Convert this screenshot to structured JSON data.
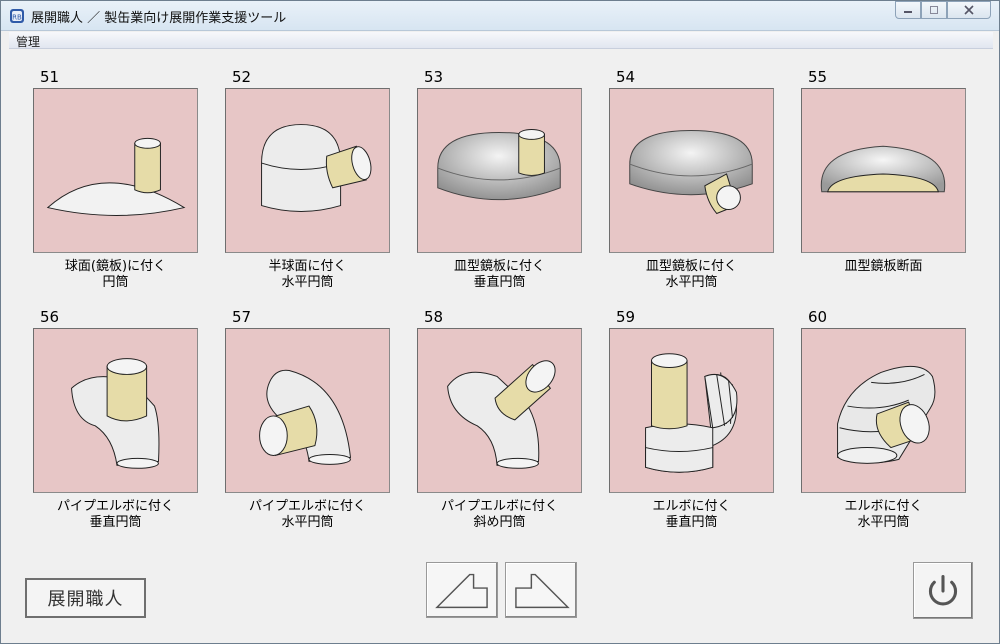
{
  "window": {
    "title": "展開職人 ／ 製缶業向け展開作業支援ツール",
    "icon": "app-logo-icon",
    "controls": [
      "minimize",
      "maximize",
      "close"
    ]
  },
  "menu": {
    "items": [
      {
        "label": "管理"
      }
    ]
  },
  "cards": [
    {
      "number": "51",
      "line1": "球面(鏡板)に付く",
      "line2": "円筒",
      "illustration": "cylinder-on-sphere-plate"
    },
    {
      "number": "52",
      "line1": "半球面に付く",
      "line2": "水平円筒",
      "illustration": "horizontal-cylinder-on-hemisphere"
    },
    {
      "number": "53",
      "line1": "皿型鏡板に付く",
      "line2": "垂直円筒",
      "illustration": "vertical-cylinder-on-dished-head"
    },
    {
      "number": "54",
      "line1": "皿型鏡板に付く",
      "line2": "水平円筒",
      "illustration": "horizontal-cylinder-on-dished-head"
    },
    {
      "number": "55",
      "line1": "皿型鏡板断面",
      "line2": "",
      "illustration": "dished-head-section"
    },
    {
      "number": "56",
      "line1": "パイプエルボに付く",
      "line2": "垂直円筒",
      "illustration": "vertical-cylinder-on-pipe-elbow"
    },
    {
      "number": "57",
      "line1": "パイプエルボに付く",
      "line2": "水平円筒",
      "illustration": "horizontal-cylinder-on-pipe-elbow"
    },
    {
      "number": "58",
      "line1": "パイプエルボに付く",
      "line2": "斜め円筒",
      "illustration": "oblique-cylinder-on-pipe-elbow"
    },
    {
      "number": "59",
      "line1": "エルボに付く",
      "line2": "垂直円筒",
      "illustration": "vertical-cylinder-on-segmented-elbow"
    },
    {
      "number": "60",
      "line1": "エルボに付く",
      "line2": "水平円筒",
      "illustration": "horizontal-cylinder-on-segmented-elbow"
    }
  ],
  "footer": {
    "brand_label": "展開職人",
    "prev_icon": "previous-page-icon",
    "next_icon": "next-page-icon",
    "power_icon": "power-icon"
  },
  "colors": {
    "thumb_background": "#e7c6c6",
    "cylinder_fill": "#e6dca8",
    "shape_fill": "#e8e8e8"
  }
}
